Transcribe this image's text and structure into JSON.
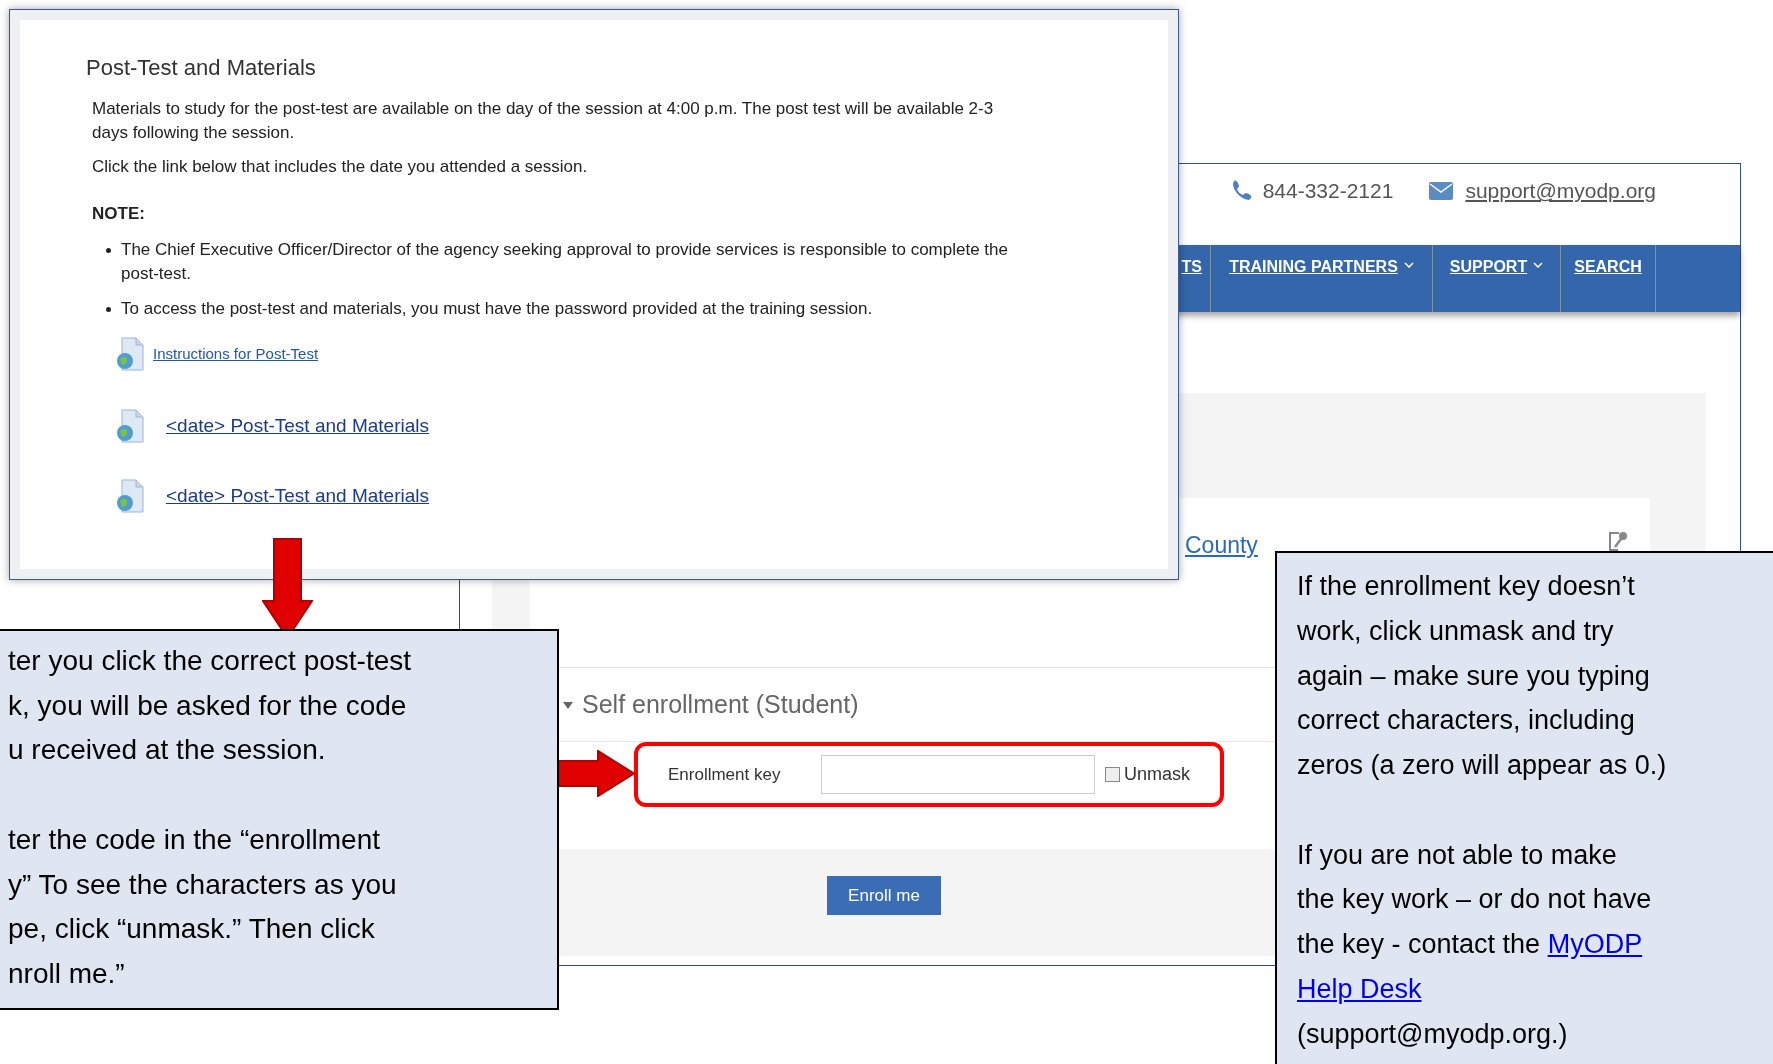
{
  "website": {
    "phone": "844-332-2121",
    "email": "support@myodp.org",
    "nav": [
      {
        "label": "TS",
        "dropdown": false
      },
      {
        "label": "TRAINING PARTNERS",
        "dropdown": true
      },
      {
        "label": "SUPPORT",
        "dropdown": true
      },
      {
        "label": "SEARCH",
        "dropdown": false
      }
    ],
    "course_link": "County",
    "enrollment": {
      "title": "Self enrollment (Student)",
      "expanded": true,
      "key_label": "Enrollment key",
      "unmask": {
        "label": "Unmask",
        "checked": false
      },
      "button": "Enroll me"
    }
  },
  "post_test_panel": {
    "title": "Post-Test and Materials",
    "paragraphs": [
      "Materials to study for the post-test are available on the day of the session at 4:00 p.m. The post test will be available 2-3 days following the session.",
      "Click the link below that includes the date you attended a session."
    ],
    "note_heading": "NOTE:",
    "bullets": [
      "The Chief Executive Officer/Director of the agency seeking approval to provide services is responsible to complete the post-test.",
      "To access the post-test and materials, you must have the password provided at the training session."
    ],
    "links": [
      {
        "label": "Instructions for Post-Test",
        "kind": "small"
      },
      {
        "label": "<date> Post-Test and Materials",
        "kind": "large"
      },
      {
        "label": "<date> Post-Test and Materials",
        "kind": "large"
      }
    ]
  },
  "callouts": [
    {
      "paragraphs": [
        [
          {
            "kind": "text",
            "text": "ter you click the correct post-test\nk, you will be asked for the code\nu received at the session."
          }
        ],
        [
          {
            "kind": "text",
            "text": "ter the code in the “enrollment\ny” To see the characters as you\npe, click “unmask.” Then click\nnroll me.”"
          }
        ]
      ]
    },
    {
      "paragraphs": [
        [
          {
            "kind": "text",
            "text": "If the enrollment key doesn’t\nwork, click unmask and try\nagain – make sure you typing\ncorrect characters, including\nzeros (a zero will appear as 0.)"
          }
        ],
        [
          {
            "kind": "text",
            "text": "If you are not able to make\nthe key work – or do not have\nthe key -  contact the "
          },
          {
            "kind": "link",
            "text": "MyODP"
          },
          {
            "kind": "break"
          },
          {
            "kind": "link",
            "text": "Help Desk"
          },
          {
            "kind": "text",
            "text": "\n(support@myodp.org.)"
          }
        ]
      ]
    }
  ]
}
